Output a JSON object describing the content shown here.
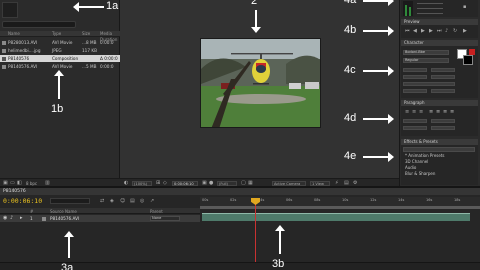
{
  "project_panel": {
    "columns": [
      "Name",
      "Type",
      "Size",
      "Media Duration"
    ],
    "items": [
      {
        "name": "P8280013.AVI",
        "type": "AVI Movie",
        "size": "...8 MB",
        "duration": "0:00:0",
        "selected": false
      },
      {
        "name": "helimedbi....jpg",
        "type": "JPEG",
        "size": "117 KB",
        "duration": "",
        "selected": false
      },
      {
        "name": "P8140576",
        "type": "Composition",
        "size": "",
        "duration": "Δ 0:00:0",
        "selected": true
      },
      {
        "name": "P8140576.AVI",
        "type": "AVI Movie",
        "size": "...5 MB",
        "duration": "0:00:0",
        "selected": false
      }
    ],
    "bit_depth": "8 bpc"
  },
  "viewer_bar": {
    "zoom": "(100%)",
    "timecode": "0:00:06:10",
    "resolution": "(Full)",
    "camera": "Active Camera",
    "views": "1 View"
  },
  "right_panels": {
    "preview_tab": "Preview",
    "character_tab": "Character",
    "font_name": "Bodoni-Bbe",
    "font_style": "Regular",
    "paragraph_tab": "Paragraph",
    "effects_tab": "Effects & Presets",
    "effects_items": [
      "* Animation Presets",
      "3D Channel",
      "Audio",
      "Blur & Sharpen"
    ]
  },
  "timeline": {
    "tab": "P8140576",
    "current_time": "0:00:06:10",
    "layer_header": [
      "#",
      "Source Name",
      "Parent"
    ],
    "layer": {
      "index": "1",
      "name": "P8140576.AVI",
      "parent": "None"
    },
    "ruler_labels": [
      "00s",
      "02s",
      "04s",
      "06s",
      "08s",
      "10s",
      "12s",
      "14s",
      "16s",
      "18s"
    ]
  },
  "callouts": {
    "c1a": "1a",
    "c1b": "1b",
    "c2": "2",
    "c3a": "3a",
    "c3b": "3b",
    "c4a": "4a",
    "c4b": "4b",
    "c4c": "4c",
    "c4d": "4d",
    "c4e": "4e"
  },
  "colors": {
    "timecode": "#e8c020",
    "layer_bar": "#4e7a6a",
    "current_time_indicator": "#c83232",
    "callout": "#ffffff"
  }
}
